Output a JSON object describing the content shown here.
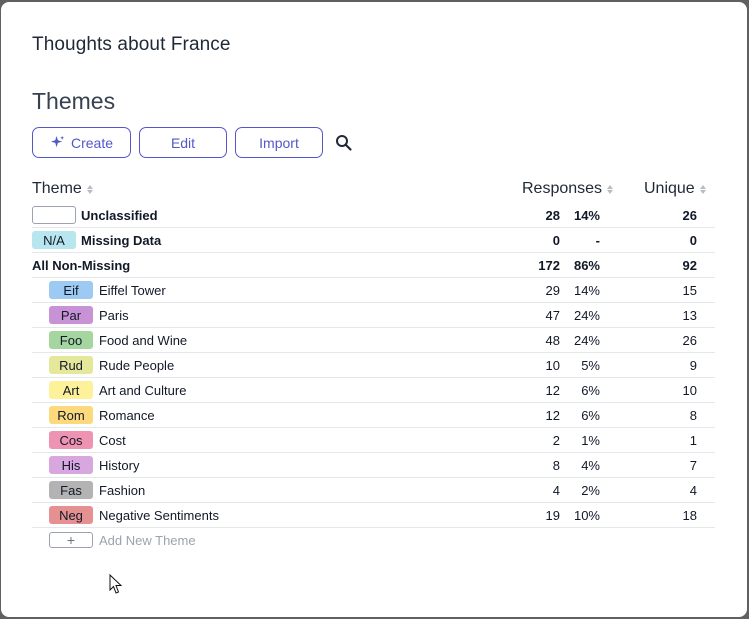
{
  "header": {
    "title": "Thoughts about France"
  },
  "section": {
    "title": "Themes"
  },
  "toolbar": {
    "create_label": "Create",
    "edit_label": "Edit",
    "import_label": "Import"
  },
  "columns": {
    "theme": "Theme",
    "responses": "Responses",
    "unique": "Unique"
  },
  "special_rows": [
    {
      "tag": "",
      "label": "Unclassified",
      "responses": "28",
      "percent": "14%",
      "unique": "26",
      "chip_color": "#ffffff",
      "chip_border": "#9ca3af"
    },
    {
      "tag": "N/A",
      "label": "Missing Data",
      "responses": "0",
      "percent": "-",
      "unique": "0",
      "chip_color": "#b8e6ee",
      "chip_border": "#b8e6ee"
    },
    {
      "label": "All Non-Missing",
      "responses": "172",
      "percent": "86%",
      "unique": "92"
    }
  ],
  "themes": [
    {
      "tag": "Eif",
      "name": "Eiffel Tower",
      "responses": "29",
      "percent": "14%",
      "unique": "15",
      "color": "#9ccaf2"
    },
    {
      "tag": "Par",
      "name": "Paris",
      "responses": "47",
      "percent": "24%",
      "unique": "13",
      "color": "#c892d6"
    },
    {
      "tag": "Foo",
      "name": "Food and Wine",
      "responses": "48",
      "percent": "24%",
      "unique": "26",
      "color": "#a5d6a0"
    },
    {
      "tag": "Rud",
      "name": "Rude People",
      "responses": "10",
      "percent": "5%",
      "unique": "9",
      "color": "#e5e89a"
    },
    {
      "tag": "Art",
      "name": "Art and Culture",
      "responses": "12",
      "percent": "6%",
      "unique": "10",
      "color": "#fdf29a"
    },
    {
      "tag": "Rom",
      "name": "Romance",
      "responses": "12",
      "percent": "6%",
      "unique": "8",
      "color": "#fdd97e"
    },
    {
      "tag": "Cos",
      "name": "Cost",
      "responses": "2",
      "percent": "1%",
      "unique": "1",
      "color": "#ee93b1"
    },
    {
      "tag": "His",
      "name": "History",
      "responses": "8",
      "percent": "4%",
      "unique": "7",
      "color": "#d8a7df"
    },
    {
      "tag": "Fas",
      "name": "Fashion",
      "responses": "4",
      "percent": "2%",
      "unique": "4",
      "color": "#b3b3b3"
    },
    {
      "tag": "Neg",
      "name": "Negative Sentiments",
      "responses": "19",
      "percent": "10%",
      "unique": "18",
      "color": "#e69191"
    }
  ],
  "add_theme": {
    "plus": "+",
    "label": "Add New Theme"
  },
  "icons": {
    "create": "sparkle-icon",
    "search": "search-icon",
    "sort": "sort-icon",
    "cursor": "mouse-pointer-icon"
  },
  "colors": {
    "accent": "#5358c9"
  }
}
